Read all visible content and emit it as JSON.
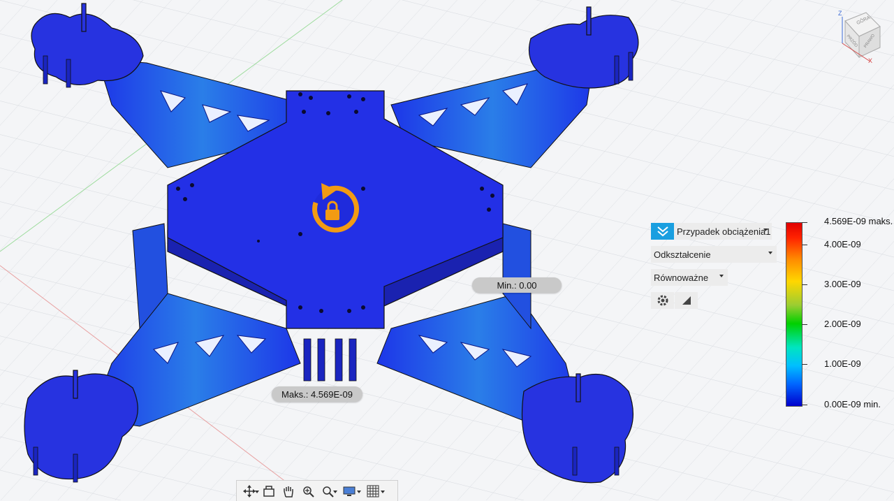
{
  "markers": {
    "min": "Min.: 0.00",
    "max": "Maks.: 4.569E-09"
  },
  "panel": {
    "load_case": "Przypadek obciążenia1",
    "result_type": "Odkształcenie",
    "component": "Równoważne"
  },
  "legend": {
    "max_label": "4.569E-09",
    "max_suffix": "maks.",
    "ticks": [
      "4.00E-09",
      "3.00E-09",
      "2.00E-09",
      "1.00E-09"
    ],
    "min_label": "0.00E-09",
    "min_suffix": "min."
  },
  "viewcube": {
    "top": "GÓRA",
    "front": "PRZÓD",
    "right": "PRAWO",
    "axis_z": "Z",
    "axis_x": "X"
  },
  "colors": {
    "accent": "#1a9fe0",
    "mesh": "#1f2bdc",
    "lock": "#f29b13"
  },
  "navbar": {
    "icons": [
      "orbit-icon",
      "look-at-icon",
      "pan-icon",
      "zoom-window-icon",
      "zoom-icon",
      "display-settings-icon",
      "grid-icon"
    ]
  }
}
